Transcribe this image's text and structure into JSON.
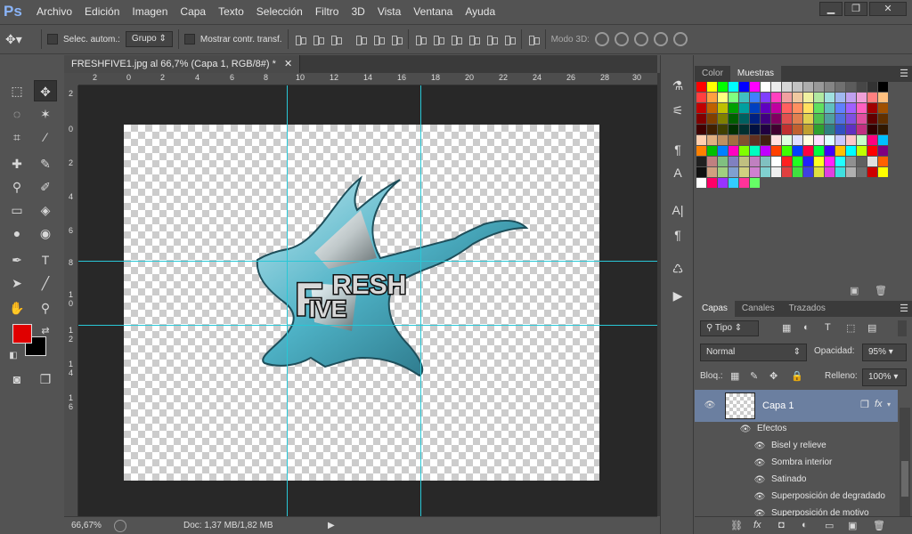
{
  "app": {
    "logo": "Ps"
  },
  "menu": [
    "Archivo",
    "Edición",
    "Imagen",
    "Capa",
    "Texto",
    "Selección",
    "Filtro",
    "3D",
    "Vista",
    "Ventana",
    "Ayuda"
  ],
  "window_controls": {
    "minimize": "▁",
    "restore": "❐",
    "close": "✕"
  },
  "options": {
    "auto_select_label": "Selec. autom.:",
    "auto_select_value": "Grupo",
    "transform_label": "Mostrar contr. transf.",
    "mode3d_label": "Modo 3D:"
  },
  "document": {
    "tab_title": "FRESHFIVE1.jpg al 66,7% (Capa 1, RGB/8#) *",
    "ruler_top": [
      "2",
      "0",
      "2",
      "4",
      "6",
      "8",
      "10",
      "12",
      "14",
      "16",
      "18",
      "20",
      "22",
      "24",
      "26",
      "28",
      "30"
    ],
    "ruler_left": [
      "2",
      "0",
      "2",
      "4",
      "6",
      "8",
      "1\n0",
      "1\n2",
      "1\n4",
      "1\n6"
    ],
    "zoom": "66,67%",
    "doc_info": "Doc: 1,37 MB/1,82 MB",
    "artwork_text_top": "RESH",
    "artwork_text_f": "F",
    "artwork_text_bottom": "IVE"
  },
  "swatch_panel": {
    "tabs": [
      "Color",
      "Muestras"
    ],
    "active_tab": "Muestras",
    "swatches": [
      "#ff0000",
      "#ffff00",
      "#00ff00",
      "#00ffff",
      "#0000ff",
      "#ff00ff",
      "#ffffff",
      "#ebebeb",
      "#d6d6d6",
      "#c2c2c2",
      "#adadad",
      "#999999",
      "#858585",
      "#707070",
      "#5c5c5c",
      "#474747",
      "#333333",
      "#000000",
      "#ff4040",
      "#ffa040",
      "#ffff80",
      "#80ff80",
      "#40c0c0",
      "#4080ff",
      "#8040ff",
      "#ff40c0",
      "#f0a0a0",
      "#f0c8a0",
      "#f0f0a0",
      "#b0e8a0",
      "#a0e0e0",
      "#a0b8f0",
      "#c0a0f0",
      "#f0a0d8",
      "#ff8080",
      "#ffc080",
      "#c00000",
      "#c06000",
      "#c0c000",
      "#00a000",
      "#00a0a0",
      "#0040c0",
      "#6000c0",
      "#c000a0",
      "#ff6060",
      "#ff9060",
      "#ffe060",
      "#60e060",
      "#60c0c0",
      "#6080ff",
      "#a060ff",
      "#ff60c0",
      "#a00000",
      "#a05000",
      "#800000",
      "#804000",
      "#808000",
      "#006000",
      "#006060",
      "#002080",
      "#400080",
      "#800060",
      "#e05050",
      "#e08050",
      "#e0d050",
      "#50c050",
      "#50a0a0",
      "#5070e0",
      "#8050e0",
      "#e050a0",
      "#600000",
      "#603000",
      "#400000",
      "#402000",
      "#404000",
      "#003000",
      "#003030",
      "#001040",
      "#200040",
      "#400030",
      "#c03030",
      "#c06030",
      "#c0a030",
      "#30a030",
      "#308080",
      "#3050c0",
      "#6030c0",
      "#c03080",
      "#300000",
      "#301800",
      "#ffd0b0",
      "#e0b080",
      "#c09060",
      "#a07040",
      "#805030",
      "#603020",
      "#402010",
      "#ffe0e0",
      "#e0ffe0",
      "#e0e0ff",
      "#ffffe0",
      "#ffe0ff",
      "#e0ffff",
      "#c8c8ff",
      "#ffc8c8",
      "#c8ffc8",
      "#ff0080",
      "#00c0ff",
      "#ff8000",
      "#00c000",
      "#0080ff",
      "#ff00c0",
      "#80ff00",
      "#00ffc0",
      "#c000ff",
      "#ff4000",
      "#40ff00",
      "#0040ff",
      "#ff0040",
      "#00ff40",
      "#4000ff",
      "#ffc000",
      "#00ffff",
      "#c0ff00",
      "#ff0000",
      "#800080",
      "#202020",
      "#c08080",
      "#80c080",
      "#8080c0",
      "#c0c080",
      "#c080c0",
      "#80c0c0",
      "#ffffff",
      "#ff2020",
      "#20ff20",
      "#2020ff",
      "#ffff20",
      "#ff20ff",
      "#20ffff",
      "#909090",
      "#606060",
      "#e0e0e0",
      "#ff6000",
      "#101010",
      "#d0a080",
      "#a0d080",
      "#80a0d0",
      "#d0d080",
      "#d080d0",
      "#80d0d0",
      "#f0f0f0",
      "#e04040",
      "#40e040",
      "#4040e0",
      "#e0e040",
      "#e040e0",
      "#40e0e0",
      "#b0b0b0",
      "#707070",
      "#cc0000",
      "#ffff00",
      "#ffffff",
      "#ff0066",
      "#9933ff",
      "#33ccff",
      "#ff3399",
      "#66ff66"
    ]
  },
  "layers_panel": {
    "tabs": [
      "Capas",
      "Canales",
      "Trazados"
    ],
    "active_tab": "Capas",
    "filter_label": "Tipo",
    "blend_mode": "Normal",
    "opacity_label": "Opacidad:",
    "opacity_value": "95%",
    "lock_label": "Bloq.:",
    "fill_label": "Relleno:",
    "fill_value": "100%",
    "layer_name": "Capa 1",
    "fx_label": "fx",
    "effects_label": "Efectos",
    "effects": [
      "Bisel y relieve",
      "Sombra interior",
      "Satinado",
      "Superposición de degradado",
      "Superposición de motivo"
    ]
  },
  "colors": {
    "foreground": "#e00000",
    "background": "#000000",
    "guide": "#29c7d6",
    "accent": "#6b7fa0"
  }
}
